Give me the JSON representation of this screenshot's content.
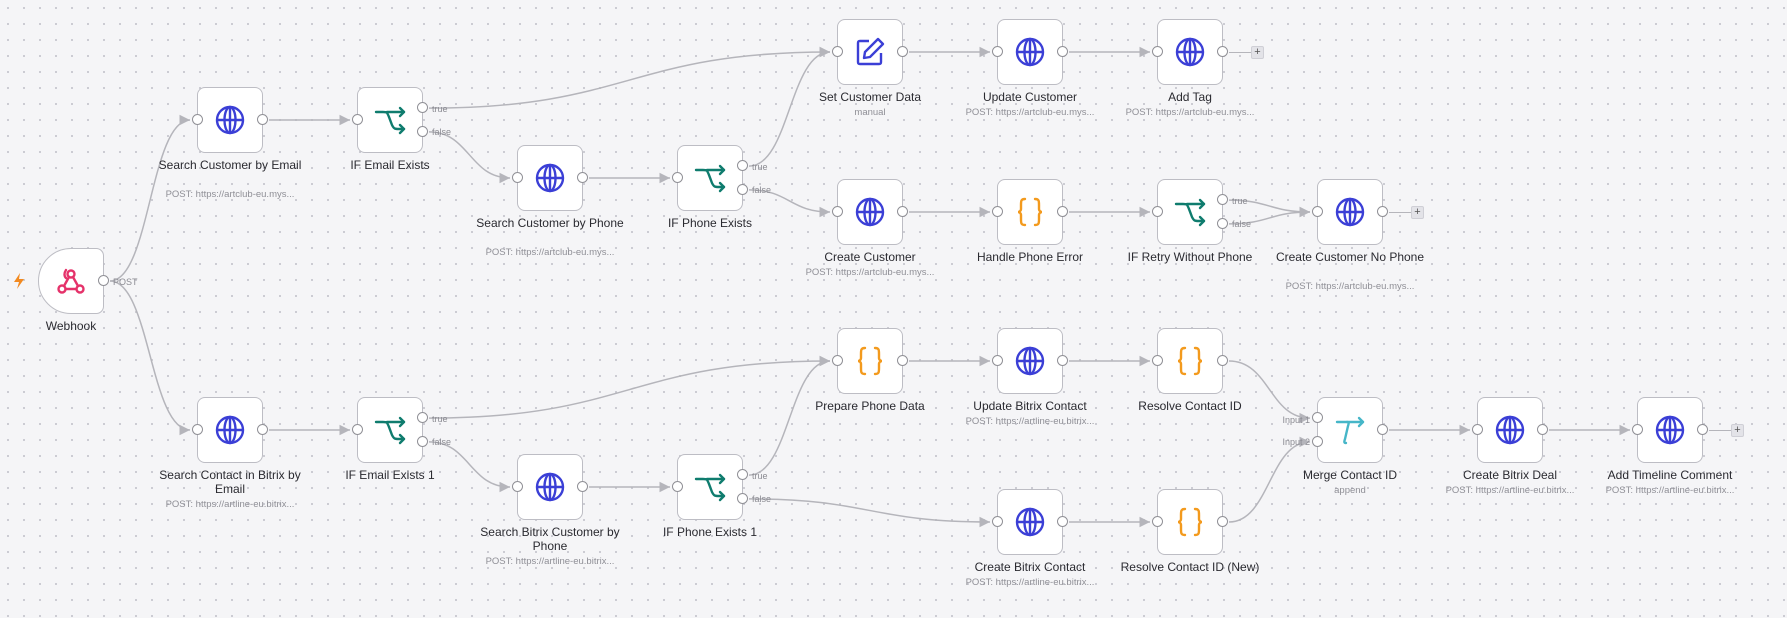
{
  "colors": {
    "globe": "#3b3fd6",
    "if": "#0f7c6e",
    "code": "#f39a1d",
    "webhook": "#e5326a",
    "set": "#3b3fd6",
    "merge": "#46b6c8",
    "bolt": "#f28a21",
    "edge": "#b5b5bb"
  },
  "nodes": [
    {
      "id": "webhook",
      "title": "Webhook",
      "subtitle": "",
      "icon": "webhook-icon",
      "handle_label": "POST"
    },
    {
      "id": "search-email",
      "title": "Search Customer by Email",
      "subtitle": "POST: https://artclub-eu.mys...",
      "icon": "globe-icon"
    },
    {
      "id": "if-email",
      "title": "IF Email Exists",
      "subtitle": "",
      "icon": "if-icon",
      "out_labels": [
        "true",
        "false"
      ]
    },
    {
      "id": "search-phone",
      "title": "Search Customer by Phone",
      "subtitle": "POST: https://artclub-eu.mys...",
      "icon": "globe-icon"
    },
    {
      "id": "if-phone",
      "title": "IF Phone Exists",
      "subtitle": "",
      "icon": "if-icon",
      "out_labels": [
        "true",
        "false"
      ]
    },
    {
      "id": "set-data",
      "title": "Set Customer Data",
      "subtitle": "manual",
      "icon": "edit-icon"
    },
    {
      "id": "update-customer",
      "title": "Update Customer",
      "subtitle": "POST: https://artclub-eu.mys...",
      "icon": "globe-icon"
    },
    {
      "id": "add-tag",
      "title": "Add Tag",
      "subtitle": "POST: https://artclub-eu.mys...",
      "icon": "globe-icon"
    },
    {
      "id": "create-customer",
      "title": "Create Customer",
      "subtitle": "POST: https://artclub-eu.mys...",
      "icon": "globe-icon"
    },
    {
      "id": "handle-phone-error",
      "title": "Handle Phone Error",
      "subtitle": "",
      "icon": "code-icon"
    },
    {
      "id": "if-retry",
      "title": "IF Retry Without Phone",
      "subtitle": "",
      "icon": "if-icon",
      "out_labels": [
        "true",
        "false"
      ]
    },
    {
      "id": "create-no-phone",
      "title": "Create Customer No Phone",
      "subtitle": "POST: https://artclub-eu.mys...",
      "icon": "globe-icon"
    },
    {
      "id": "search-bitrix-email",
      "title": "Search Contact in Bitrix by Email",
      "subtitle": "POST: https://artline-eu.bitrix...",
      "icon": "globe-icon"
    },
    {
      "id": "if-email-1",
      "title": "IF Email Exists 1",
      "subtitle": "",
      "icon": "if-icon",
      "out_labels": [
        "true",
        "false"
      ]
    },
    {
      "id": "search-bitrix-phone",
      "title": "Search Bitrix Customer by Phone",
      "subtitle": "POST: https://artline-eu.bitrix...",
      "icon": "globe-icon"
    },
    {
      "id": "if-phone-1",
      "title": "IF Phone Exists 1",
      "subtitle": "",
      "icon": "if-icon",
      "out_labels": [
        "true",
        "false"
      ]
    },
    {
      "id": "prepare-phone",
      "title": "Prepare Phone Data",
      "subtitle": "",
      "icon": "code-icon"
    },
    {
      "id": "update-bitrix",
      "title": "Update Bitrix Contact",
      "subtitle": "POST: https://artline-eu.bitrix...",
      "icon": "globe-icon"
    },
    {
      "id": "resolve-id",
      "title": "Resolve Contact ID",
      "subtitle": "",
      "icon": "code-icon"
    },
    {
      "id": "create-bitrix",
      "title": "Create Bitrix Contact",
      "subtitle": "POST: https://artline-eu.bitrix...",
      "icon": "globe-icon"
    },
    {
      "id": "resolve-id-new",
      "title": "Resolve Contact ID (New)",
      "subtitle": "",
      "icon": "code-icon"
    },
    {
      "id": "merge",
      "title": "Merge Contact ID",
      "subtitle": "append",
      "icon": "merge-icon",
      "in_labels": [
        "Input 1",
        "Input 2"
      ]
    },
    {
      "id": "create-deal",
      "title": "Create Bitrix Deal",
      "subtitle": "POST: https://artline-eu.bitrix...",
      "icon": "globe-icon"
    },
    {
      "id": "add-comment",
      "title": "Add Timeline Comment",
      "subtitle": "POST: https://artline-eu.bitrix...",
      "icon": "globe-icon"
    }
  ],
  "plus_label": "+"
}
